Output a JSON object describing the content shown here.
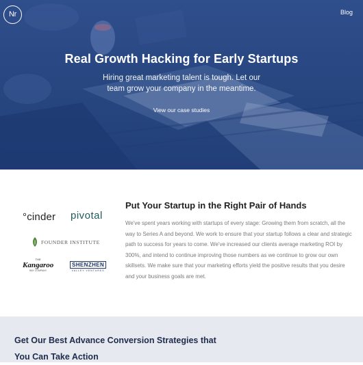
{
  "header": {
    "logo_text": "Nr",
    "nav_blog": "Blog"
  },
  "hero": {
    "title": "Real Growth Hacking for Early Startups",
    "subtitle": "Hiring great marketing talent is tough. Let our team grow your company in the meantime.",
    "link": "View our case studies"
  },
  "clients": {
    "cinder": "°cinder",
    "pivotal": "pivotal",
    "founder": "FOUNDER INSTITUTE",
    "kangaroo_the": "THE",
    "kangaroo": "Kangaroo",
    "kangaroo_sub": "BAY COMPANY",
    "shenzhen": "SHENZHEN",
    "shenzhen_sub": "VALLEY VENTURES"
  },
  "about": {
    "title": "Put Your Startup in the Right Pair of Hands",
    "body": "We've spent years working with startups of every stage: Growing them from scratch, all the way to Series A and beyond. We work to ensure that your startup follows a clear and strategic path to success for years to come. We've increased our clients average marketing ROI by 300%, and intend to continue improving those numbers as we continue to grow our own skillsets. We make sure that your marketing efforts yield the positive results that you desire and your business goals are met."
  },
  "cta": {
    "title": "Get Our Best Advance Conversion Strategies that You Can Take Action"
  },
  "colors": {
    "hero_overlay": "#2a4a86",
    "accent_navy": "#1e3566",
    "cta_background": "#e6e9f0",
    "pivotal_teal": "#1f5a5e"
  }
}
